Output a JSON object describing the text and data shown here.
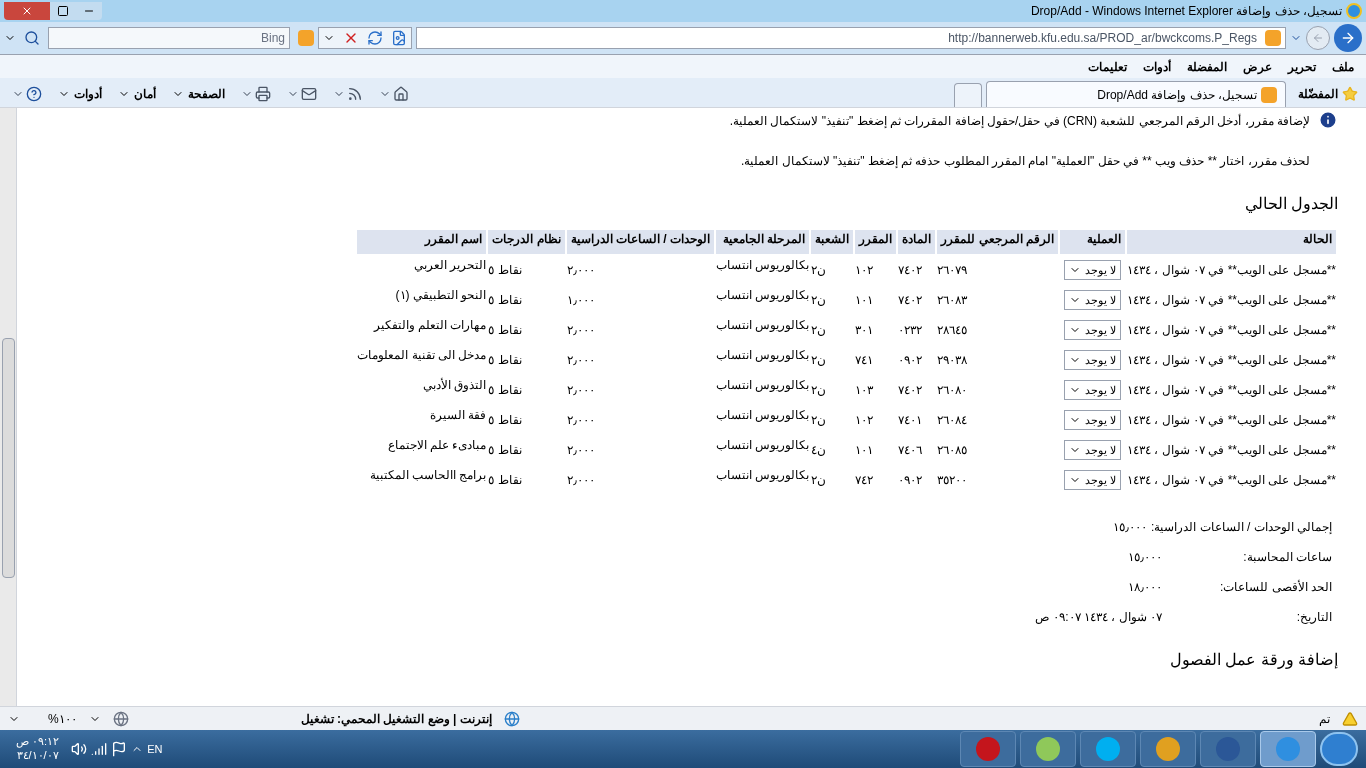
{
  "window": {
    "title": "تسجيل، حذف وإضافة Drop/Add - Windows Internet Explorer"
  },
  "address": {
    "url": "http://bannerweb.kfu.edu.sa/PROD_ar/bwckcoms.P_Regs"
  },
  "search": {
    "placeholder": "Bing"
  },
  "menu": [
    "ملف",
    "تحرير",
    "عرض",
    "المفضلة",
    "أدوات",
    "تعليمات"
  ],
  "favorites": {
    "label": "المفضّلة"
  },
  "tabs": [
    {
      "label": "تسجيل، حذف وإضافة Drop/Add",
      "selected": true
    }
  ],
  "command_bar": [
    {
      "kind": "home"
    },
    {
      "kind": "rss"
    },
    {
      "kind": "mail"
    },
    {
      "kind": "print"
    },
    {
      "kind": "menu",
      "label": "الصفحة"
    },
    {
      "kind": "menu",
      "label": "أمان"
    },
    {
      "kind": "menu",
      "label": "أدوات"
    },
    {
      "kind": "help"
    }
  ],
  "page": {
    "info": [
      "لإضافة مقرر، أدخل الرقم المرجعي للشعبة (CRN) في حقل/حقول إضافة المقررات ثم إضغط \"تنفيذ\" لاستكمال العملية.",
      "لحذف مقرر، اختار ** حذف ويب ** في حقل \"العملية\" امام المقرر المطلوب حذفه ثم إضغط \"تنفيذ\" لاستكمال العملية."
    ],
    "schedule_title": "الجدول الحالي",
    "table": {
      "columns": [
        "الحالة",
        "العملية",
        "الرقم المرجعي للمقرر",
        "المادة",
        "المقرر",
        "الشعبة",
        "المرحلة الجامعية",
        "الوحدات / الساعات الدراسية",
        "نظام الدرجات",
        "اسم المقرر"
      ],
      "rows": [
        {
          "status": "**مسجل على الويب** في ٠٧ شوال ، ١٤٣٤",
          "action": "لا يوجد",
          "crn": "٢٦٠٧٩",
          "subject": "٧٤٠٢",
          "course": "١٠٢",
          "section": "ن٢",
          "level": "بكالوريوس انتساب",
          "units": "٢٫٠٠٠",
          "grading": "نقاط ٥",
          "title": "التحرير العربي"
        },
        {
          "status": "**مسجل على الويب** في ٠٧ شوال ، ١٤٣٤",
          "action": "لا يوجد",
          "crn": "٢٦٠٨٣",
          "subject": "٧٤٠٢",
          "course": "١٠١",
          "section": "ن٢",
          "level": "بكالوريوس انتساب",
          "units": "١٫٠٠٠",
          "grading": "نقاط ٥",
          "title": "النحو التطبيقي (١)"
        },
        {
          "status": "**مسجل على الويب** في ٠٧ شوال ، ١٤٣٤",
          "action": "لا يوجد",
          "crn": "٢٨٦٤٥",
          "subject": "٠٢٣٢",
          "course": "٣٠١",
          "section": "ن٢",
          "level": "بكالوريوس انتساب",
          "units": "٢٫٠٠٠",
          "grading": "نقاط ٥",
          "title": "مهارات التعلم والتفكير"
        },
        {
          "status": "**مسجل على الويب** في ٠٧ شوال ، ١٤٣٤",
          "action": "لا يوجد",
          "crn": "٢٩٠٣٨",
          "subject": "٠٩٠٢",
          "course": "٧٤١",
          "section": "ن٢",
          "level": "بكالوريوس انتساب",
          "units": "٢٫٠٠٠",
          "grading": "نقاط ٥",
          "title": "مدخل الى تقنية المعلومات"
        },
        {
          "status": "**مسجل على الويب** في ٠٧ شوال ، ١٤٣٤",
          "action": "لا يوجد",
          "crn": "٢٦٠٨٠",
          "subject": "٧٤٠٢",
          "course": "١٠٣",
          "section": "ن٢",
          "level": "بكالوريوس انتساب",
          "units": "٢٫٠٠٠",
          "grading": "نقاط ٥",
          "title": "التذوق الأدبي"
        },
        {
          "status": "**مسجل على الويب** في ٠٧ شوال ، ١٤٣٤",
          "action": "لا يوجد",
          "crn": "٢٦٠٨٤",
          "subject": "٧٤٠١",
          "course": "١٠٢",
          "section": "ن٢",
          "level": "بكالوريوس انتساب",
          "units": "٢٫٠٠٠",
          "grading": "نقاط ٥",
          "title": "فقة السيرة"
        },
        {
          "status": "**مسجل على الويب** في ٠٧ شوال ، ١٤٣٤",
          "action": "لا يوجد",
          "crn": "٢٦٠٨٥",
          "subject": "٧٤٠٦",
          "course": "١٠١",
          "section": "ن٤",
          "level": "بكالوريوس انتساب",
          "units": "٢٫٠٠٠",
          "grading": "نقاط ٥",
          "title": "مبادىء علم الاجتماع"
        },
        {
          "status": "**مسجل على الويب** في ٠٧ شوال ، ١٤٣٤",
          "action": "لا يوجد",
          "crn": "٣٥٢٠٠",
          "subject": "٠٩٠٢",
          "course": "٧٤٢",
          "section": "ن٢",
          "level": "بكالوريوس انتساب",
          "units": "٢٫٠٠٠",
          "grading": "نقاط ٥",
          "title": "برامج االحاسب المكتبية"
        }
      ]
    },
    "totals": [
      {
        "label": "إجمالي الوحدات / الساعات الدراسية:",
        "value": "١٥٫٠٠٠"
      },
      {
        "label": "ساعات المحاسبة:",
        "value": "١٥٫٠٠٠"
      },
      {
        "label": "الحد الأقصى للساعات:",
        "value": "١٨٫٠٠٠"
      },
      {
        "label": "التاريخ:",
        "value": "٠٧ شوال ، ١٤٣٤ ٠٩:٠٧ ص"
      }
    ],
    "worksheet_title": "إضافة ورقة عمل الفصول"
  },
  "status_bar": {
    "state": "تم",
    "zone": "إنترنت | وضع التشغيل المحمي: تشغيل",
    "zoom": "١٠٠%"
  },
  "taskbar": {
    "apps": [
      {
        "kind": "ie",
        "selected": true
      },
      {
        "kind": "word",
        "selected": false
      },
      {
        "kind": "chrome",
        "selected": false
      },
      {
        "kind": "skype",
        "selected": false
      },
      {
        "kind": "folder",
        "selected": false
      },
      {
        "kind": "pdf",
        "selected": false
      }
    ],
    "language": "EN",
    "time": "٠٩:١٢ ص",
    "date": "٣٤/١٠/٠٧"
  }
}
